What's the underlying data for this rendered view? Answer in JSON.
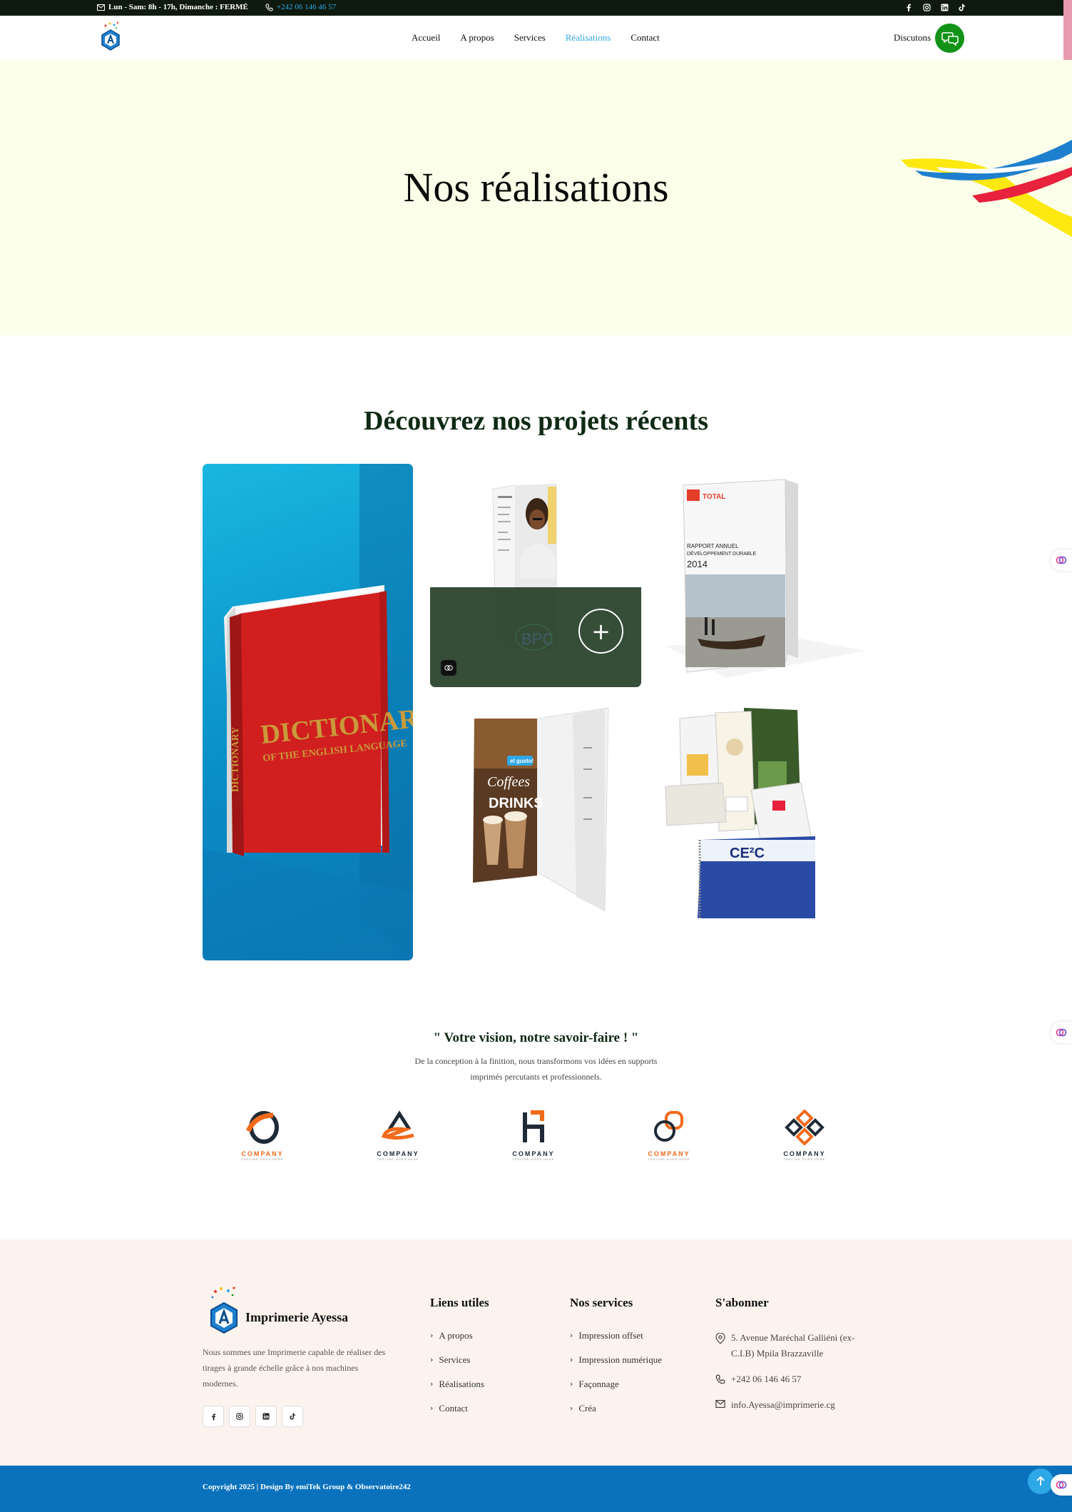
{
  "topbar": {
    "hours": "Lun - Sam: 8h - 17h, Dimanche : FERMÉ",
    "phone": "+242 06 146 46 57",
    "socials": [
      "facebook-icon",
      "instagram-icon",
      "linkedin-icon",
      "tiktok-icon"
    ]
  },
  "nav": {
    "items": [
      {
        "label": "Accueil"
      },
      {
        "label": "A propos"
      },
      {
        "label": "Services"
      },
      {
        "label": "Réalisations",
        "active": true
      },
      {
        "label": "Contact"
      }
    ],
    "discuss": "Discutons"
  },
  "hero": {
    "title": "Nos réalisations"
  },
  "projects": {
    "title": "Découvrez nos projets récents",
    "items": [
      {
        "book_title": "DICTIONARY",
        "book_subtitle": "OF THE ENGLISH LANGUAGE",
        "spine": "DICTIONARY"
      },
      {
        "label": "BPC",
        "hovered": true,
        "plus": "+"
      },
      {
        "brand": "TOTAL",
        "report_line1": "RAPPORT ANNUEL",
        "report_line2": "DÉVELOPPEMENT DURABLE",
        "year": "2014"
      },
      {
        "badge": "el gusto!",
        "line1": "Coffees",
        "line2": "DRINKS"
      },
      {
        "label": "CE²C"
      }
    ]
  },
  "quote": {
    "title": "\" Votre vision, notre savoir-faire ! \"",
    "text": "De la conception à la finition, nous transformons vos idées en supports imprimés percutants et professionnels."
  },
  "partners": [
    {
      "name": "COMPANY",
      "tagline": "TAGLINE GOES HERE",
      "color": "#f26a1b"
    },
    {
      "name": "COMPANY",
      "tagline": "TAGLINE GOES HERE",
      "color": "#1f2a36"
    },
    {
      "name": "COMPANY",
      "tagline": "TAGLINE GOES HERE",
      "color": "#1f2a36"
    },
    {
      "name": "COMPANY",
      "tagline": "TAGLINE GOES HERE",
      "color": "#f26a1b"
    },
    {
      "name": "COMPANY",
      "tagline": "TAGLINE GOES HERE",
      "color": "#1f2a36"
    }
  ],
  "footer": {
    "brand": "Imprimerie Ayessa",
    "description": "Nous sommes une Imprimerie capable de réaliser des tirages à grande échelle grâce à nos machines modernes.",
    "links_title": "Liens utiles",
    "links": [
      "A propos",
      "Services",
      "Réalisations",
      "Contact"
    ],
    "services_title": "Nos services",
    "services": [
      "Impression offset",
      "Impression numérique",
      "Façonnage",
      "Créa"
    ],
    "subscribe_title": "S'abonner",
    "address": "5. Avenue Maréchal Galliéni (ex-C.I.B) Mpila Brazzaville",
    "phone": "+242 06 146 46 57",
    "email": "info.Ayessa@imprimerie.cg",
    "copyright": "Copyright 2025 | Design By emiTek Group & Observatoire242"
  },
  "colors": {
    "accent": "#2ea8e6",
    "whatsapp": "#129318",
    "footer_bar": "#0a72bd",
    "hero_bg": "#fbfee9",
    "footer_bg": "#fdf3ee"
  }
}
